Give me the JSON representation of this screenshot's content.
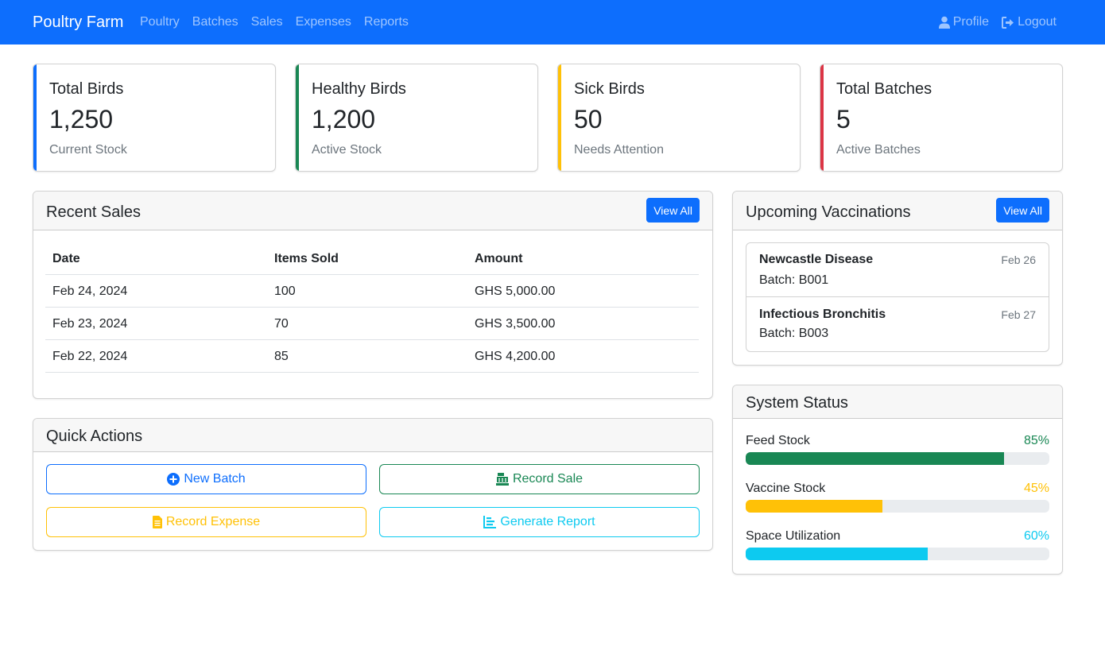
{
  "navbar": {
    "brand": "Poultry Farm",
    "links": [
      "Poultry",
      "Batches",
      "Sales",
      "Expenses",
      "Reports"
    ],
    "profile": "Profile",
    "logout": "Logout"
  },
  "stats": [
    {
      "title": "Total Birds",
      "value": "1,250",
      "sub": "Current Stock",
      "color": "#0d6efd"
    },
    {
      "title": "Healthy Birds",
      "value": "1,200",
      "sub": "Active Stock",
      "color": "#198754"
    },
    {
      "title": "Sick Birds",
      "value": "50",
      "sub": "Needs Attention",
      "color": "#ffc107"
    },
    {
      "title": "Total Batches",
      "value": "5",
      "sub": "Active Batches",
      "color": "#dc3545"
    }
  ],
  "recent_sales": {
    "title": "Recent Sales",
    "view_all": "View All",
    "columns": [
      "Date",
      "Items Sold",
      "Amount"
    ],
    "rows": [
      [
        "Feb 24, 2024",
        "100",
        "GHS 5,000.00"
      ],
      [
        "Feb 23, 2024",
        "70",
        "GHS 3,500.00"
      ],
      [
        "Feb 22, 2024",
        "85",
        "GHS 4,200.00"
      ]
    ]
  },
  "quick_actions": {
    "title": "Quick Actions",
    "buttons": [
      {
        "label": "New Batch",
        "icon": "plus-circle-icon",
        "color": "#0d6efd"
      },
      {
        "label": "Record Sale",
        "icon": "cash-register-icon",
        "color": "#198754"
      },
      {
        "label": "Record Expense",
        "icon": "file-invoice-icon",
        "color": "#ffc107"
      },
      {
        "label": "Generate Report",
        "icon": "chart-bar-icon",
        "color": "#0dcaf0"
      }
    ]
  },
  "vaccinations": {
    "title": "Upcoming Vaccinations",
    "view_all": "View All",
    "items": [
      {
        "name": "Newcastle Disease",
        "date": "Feb 26",
        "batch": "Batch: B001"
      },
      {
        "name": "Infectious Bronchitis",
        "date": "Feb 27",
        "batch": "Batch: B003"
      }
    ]
  },
  "system_status": {
    "title": "System Status",
    "items": [
      {
        "label": "Feed Stock",
        "percent": "85%",
        "value": 85,
        "color": "#198754"
      },
      {
        "label": "Vaccine Stock",
        "percent": "45%",
        "value": 45,
        "color": "#ffc107"
      },
      {
        "label": "Space Utilization",
        "percent": "60%",
        "value": 60,
        "color": "#0dcaf0"
      }
    ]
  }
}
